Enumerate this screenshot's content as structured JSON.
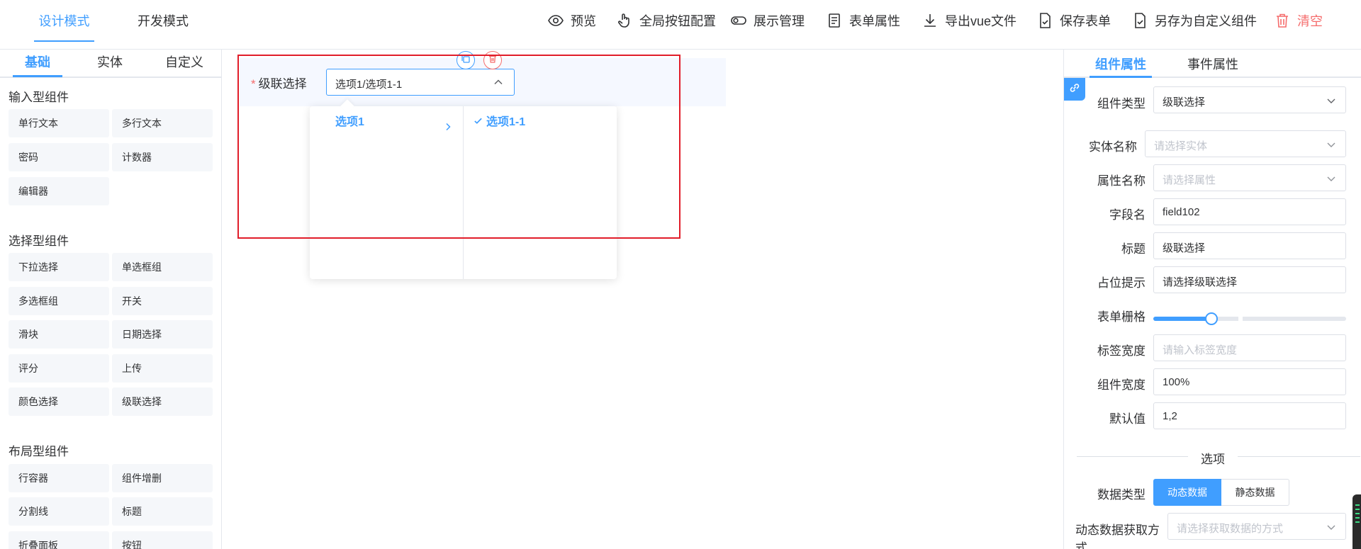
{
  "header": {
    "modes": [
      "设计模式",
      "开发模式"
    ],
    "tools": {
      "preview": "预览",
      "global_buttons": "全局按钮配置",
      "display_mgmt": "展示管理",
      "form_props": "表单属性",
      "export_vue": "导出vue文件",
      "save_form": "保存表单",
      "save_as_component": "另存为自定义组件",
      "clear": "清空"
    }
  },
  "left": {
    "tabs": [
      "基础",
      "实体",
      "自定义"
    ],
    "groups": {
      "input": {
        "title": "输入型组件",
        "items": [
          "单行文本",
          "多行文本",
          "密码",
          "计数器",
          "编辑器"
        ]
      },
      "select": {
        "title": "选择型组件",
        "items": [
          "下拉选择",
          "单选框组",
          "多选框组",
          "开关",
          "滑块",
          "日期选择",
          "评分",
          "上传",
          "颜色选择",
          "级联选择"
        ]
      },
      "layout": {
        "title": "布局型组件",
        "items": [
          "行容器",
          "组件增删",
          "分割线",
          "标题",
          "折叠面板",
          "按钮"
        ]
      }
    }
  },
  "canvas": {
    "field_label": "级联选择",
    "required_mark": "*",
    "cascader_value": "选项1/选项1-1",
    "dropdown": {
      "level1": "选项1",
      "level2": "选项1-1"
    }
  },
  "right": {
    "tabs": [
      "组件属性",
      "事件属性"
    ],
    "props": {
      "component_type": {
        "label": "组件类型",
        "value": "级联选择"
      },
      "entity_name": {
        "label": "实体名称",
        "placeholder": "请选择实体"
      },
      "attr_name": {
        "label": "属性名称",
        "placeholder": "请选择属性"
      },
      "field_name": {
        "label": "字段名",
        "value": "field102"
      },
      "title": {
        "label": "标题",
        "value": "级联选择"
      },
      "placeholder": {
        "label": "占位提示",
        "value": "请选择级联选择"
      },
      "grid": {
        "label": "表单栅格",
        "fraction": 0.3
      },
      "label_width": {
        "label": "标签宽度",
        "placeholder": "请输入标签宽度"
      },
      "comp_width": {
        "label": "组件宽度",
        "value": "100%"
      },
      "default_value": {
        "label": "默认值",
        "value": "1,2"
      }
    },
    "options_divider": "选项",
    "data_type": {
      "label": "数据类型",
      "options": [
        "动态数据",
        "静态数据"
      ],
      "selected": "动态数据"
    },
    "dynamic_fetch": {
      "label": "动态数据获取方式",
      "placeholder": "请选择获取数据的方式"
    }
  },
  "colors": {
    "primary": "#409eff",
    "danger": "#f56c6c",
    "frame": "#e11d2a"
  }
}
